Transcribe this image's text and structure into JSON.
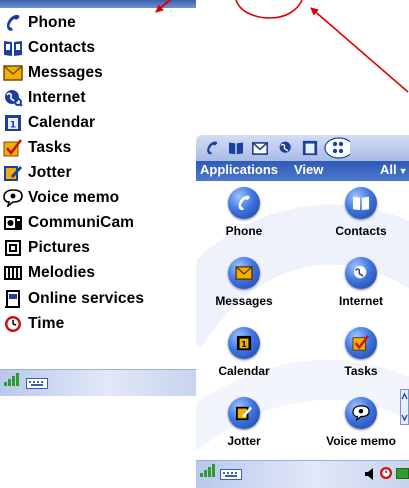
{
  "menu": {
    "items": [
      {
        "label": "Phone",
        "icon": "phone-icon"
      },
      {
        "label": "Contacts",
        "icon": "contacts-icon"
      },
      {
        "label": "Messages",
        "icon": "messages-icon"
      },
      {
        "label": "Internet",
        "icon": "internet-icon"
      },
      {
        "label": "Calendar",
        "icon": "calendar-icon"
      },
      {
        "label": "Tasks",
        "icon": "tasks-icon"
      },
      {
        "label": "Jotter",
        "icon": "jotter-icon"
      },
      {
        "label": "Voice memo",
        "icon": "voice-memo-icon"
      },
      {
        "label": "CommuniCam",
        "icon": "communicam-icon"
      },
      {
        "label": "Pictures",
        "icon": "pictures-icon"
      },
      {
        "label": "Melodies",
        "icon": "melodies-icon"
      },
      {
        "label": "Online services",
        "icon": "online-services-icon"
      },
      {
        "label": "Time",
        "icon": "time-icon"
      }
    ]
  },
  "grid": {
    "menubar": {
      "applications": "Applications",
      "view": "View",
      "filter": "All"
    },
    "toolbar_icons": [
      "phone-icon",
      "contacts-icon",
      "messages-icon",
      "internet-icon",
      "calendar-icon",
      "more-apps-icon"
    ],
    "apps": [
      {
        "label": "Phone",
        "icon": "phone-icon"
      },
      {
        "label": "Contacts",
        "icon": "contacts-icon"
      },
      {
        "label": "Messages",
        "icon": "messages-icon"
      },
      {
        "label": "Internet",
        "icon": "internet-icon"
      },
      {
        "label": "Calendar",
        "icon": "calendar-icon"
      },
      {
        "label": "Tasks",
        "icon": "tasks-icon"
      },
      {
        "label": "Jotter",
        "icon": "jotter-icon"
      },
      {
        "label": "Voice memo",
        "icon": "voice-memo-icon"
      }
    ]
  },
  "status": {
    "signal_icon": "signal-strength-icon",
    "keyboard_icon": "keyboard-icon",
    "sound_icon": "speaker-icon",
    "alarm_icon": "alarm-clock-icon",
    "battery_icon": "battery-icon"
  },
  "colors": {
    "accent_blue": "#2e5bb5",
    "annotation_red": "#e00000",
    "signal_green": "#2f9b2f"
  }
}
